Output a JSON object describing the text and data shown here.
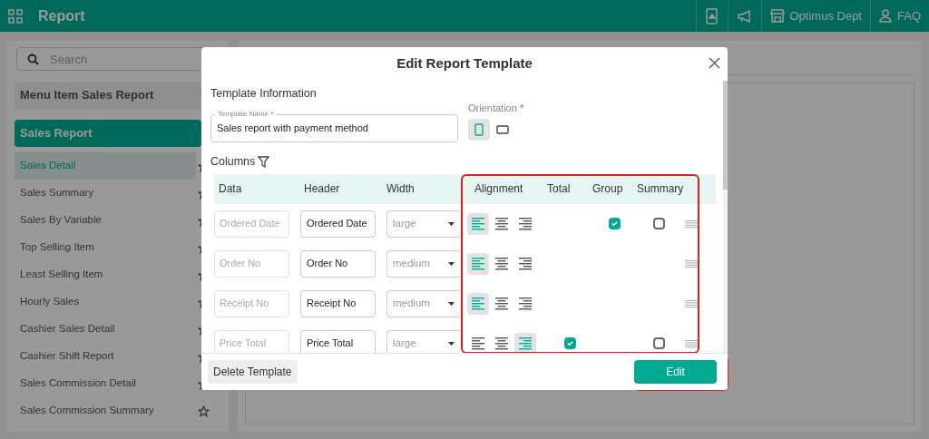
{
  "header": {
    "title": "Report",
    "store": "Optimus Dept",
    "help": "FAQ"
  },
  "sidebar": {
    "search_placeholder": "Search",
    "groups": [
      {
        "label": "Menu Item Sales Report",
        "selected": false
      },
      {
        "label": "Sales Report",
        "selected": true
      }
    ],
    "items": [
      {
        "label": "Sales Detail",
        "selected": true
      },
      {
        "label": "Sales Summary",
        "selected": false
      },
      {
        "label": "Sales By Variable",
        "selected": false
      },
      {
        "label": "Top Selling Item",
        "selected": false
      },
      {
        "label": "Least Selling Item",
        "selected": false
      },
      {
        "label": "Hourly Sales",
        "selected": false
      },
      {
        "label": "Cashier Sales Detail",
        "selected": false
      },
      {
        "label": "Cashier Shift Report",
        "selected": false
      },
      {
        "label": "Sales Commission Detail",
        "selected": false
      },
      {
        "label": "Sales Commission Summary",
        "selected": false
      }
    ]
  },
  "dialog": {
    "title": "Edit Report Template",
    "section": "Template Information",
    "name_label": "Template Name",
    "name_required_mark": "*",
    "orientation_required_mark": "*",
    "name_value": "Sales report with payment method",
    "orientation_label": "Orientation",
    "orientation": [
      {
        "kind": "portrait",
        "selected": true
      },
      {
        "kind": "landscape",
        "selected": false
      }
    ],
    "columns_label": "Columns",
    "table_headers": [
      "Data",
      "Header",
      "Width",
      "Alignment",
      "Total",
      "Group",
      "Summary"
    ],
    "rows": [
      {
        "data": "Ordered Date",
        "header": "Ordered Date",
        "width": "large",
        "alignment": [
          {
            "kind": "left",
            "selected": true
          },
          {
            "kind": "center",
            "selected": false
          },
          {
            "kind": "right",
            "selected": false
          }
        ],
        "group": true,
        "summary": false
      },
      {
        "data": "Order No",
        "header": "Order No",
        "width": "medium",
        "alignment": [
          {
            "kind": "left",
            "selected": true
          },
          {
            "kind": "center",
            "selected": false
          },
          {
            "kind": "right",
            "selected": false
          }
        ]
      },
      {
        "data": "Receipt No",
        "header": "Receipt No",
        "width": "medium",
        "alignment": [
          {
            "kind": "left",
            "selected": true
          },
          {
            "kind": "center",
            "selected": false
          },
          {
            "kind": "right",
            "selected": false
          }
        ]
      },
      {
        "data": "Price Total",
        "header": "Price Total",
        "width": "large",
        "alignment": [
          {
            "kind": "left",
            "selected": false
          },
          {
            "kind": "center",
            "selected": false
          },
          {
            "kind": "right",
            "selected": true
          }
        ],
        "total": true,
        "summary": false
      }
    ],
    "buttons": {
      "delete": "Delete Template",
      "edit": "Edit"
    }
  }
}
